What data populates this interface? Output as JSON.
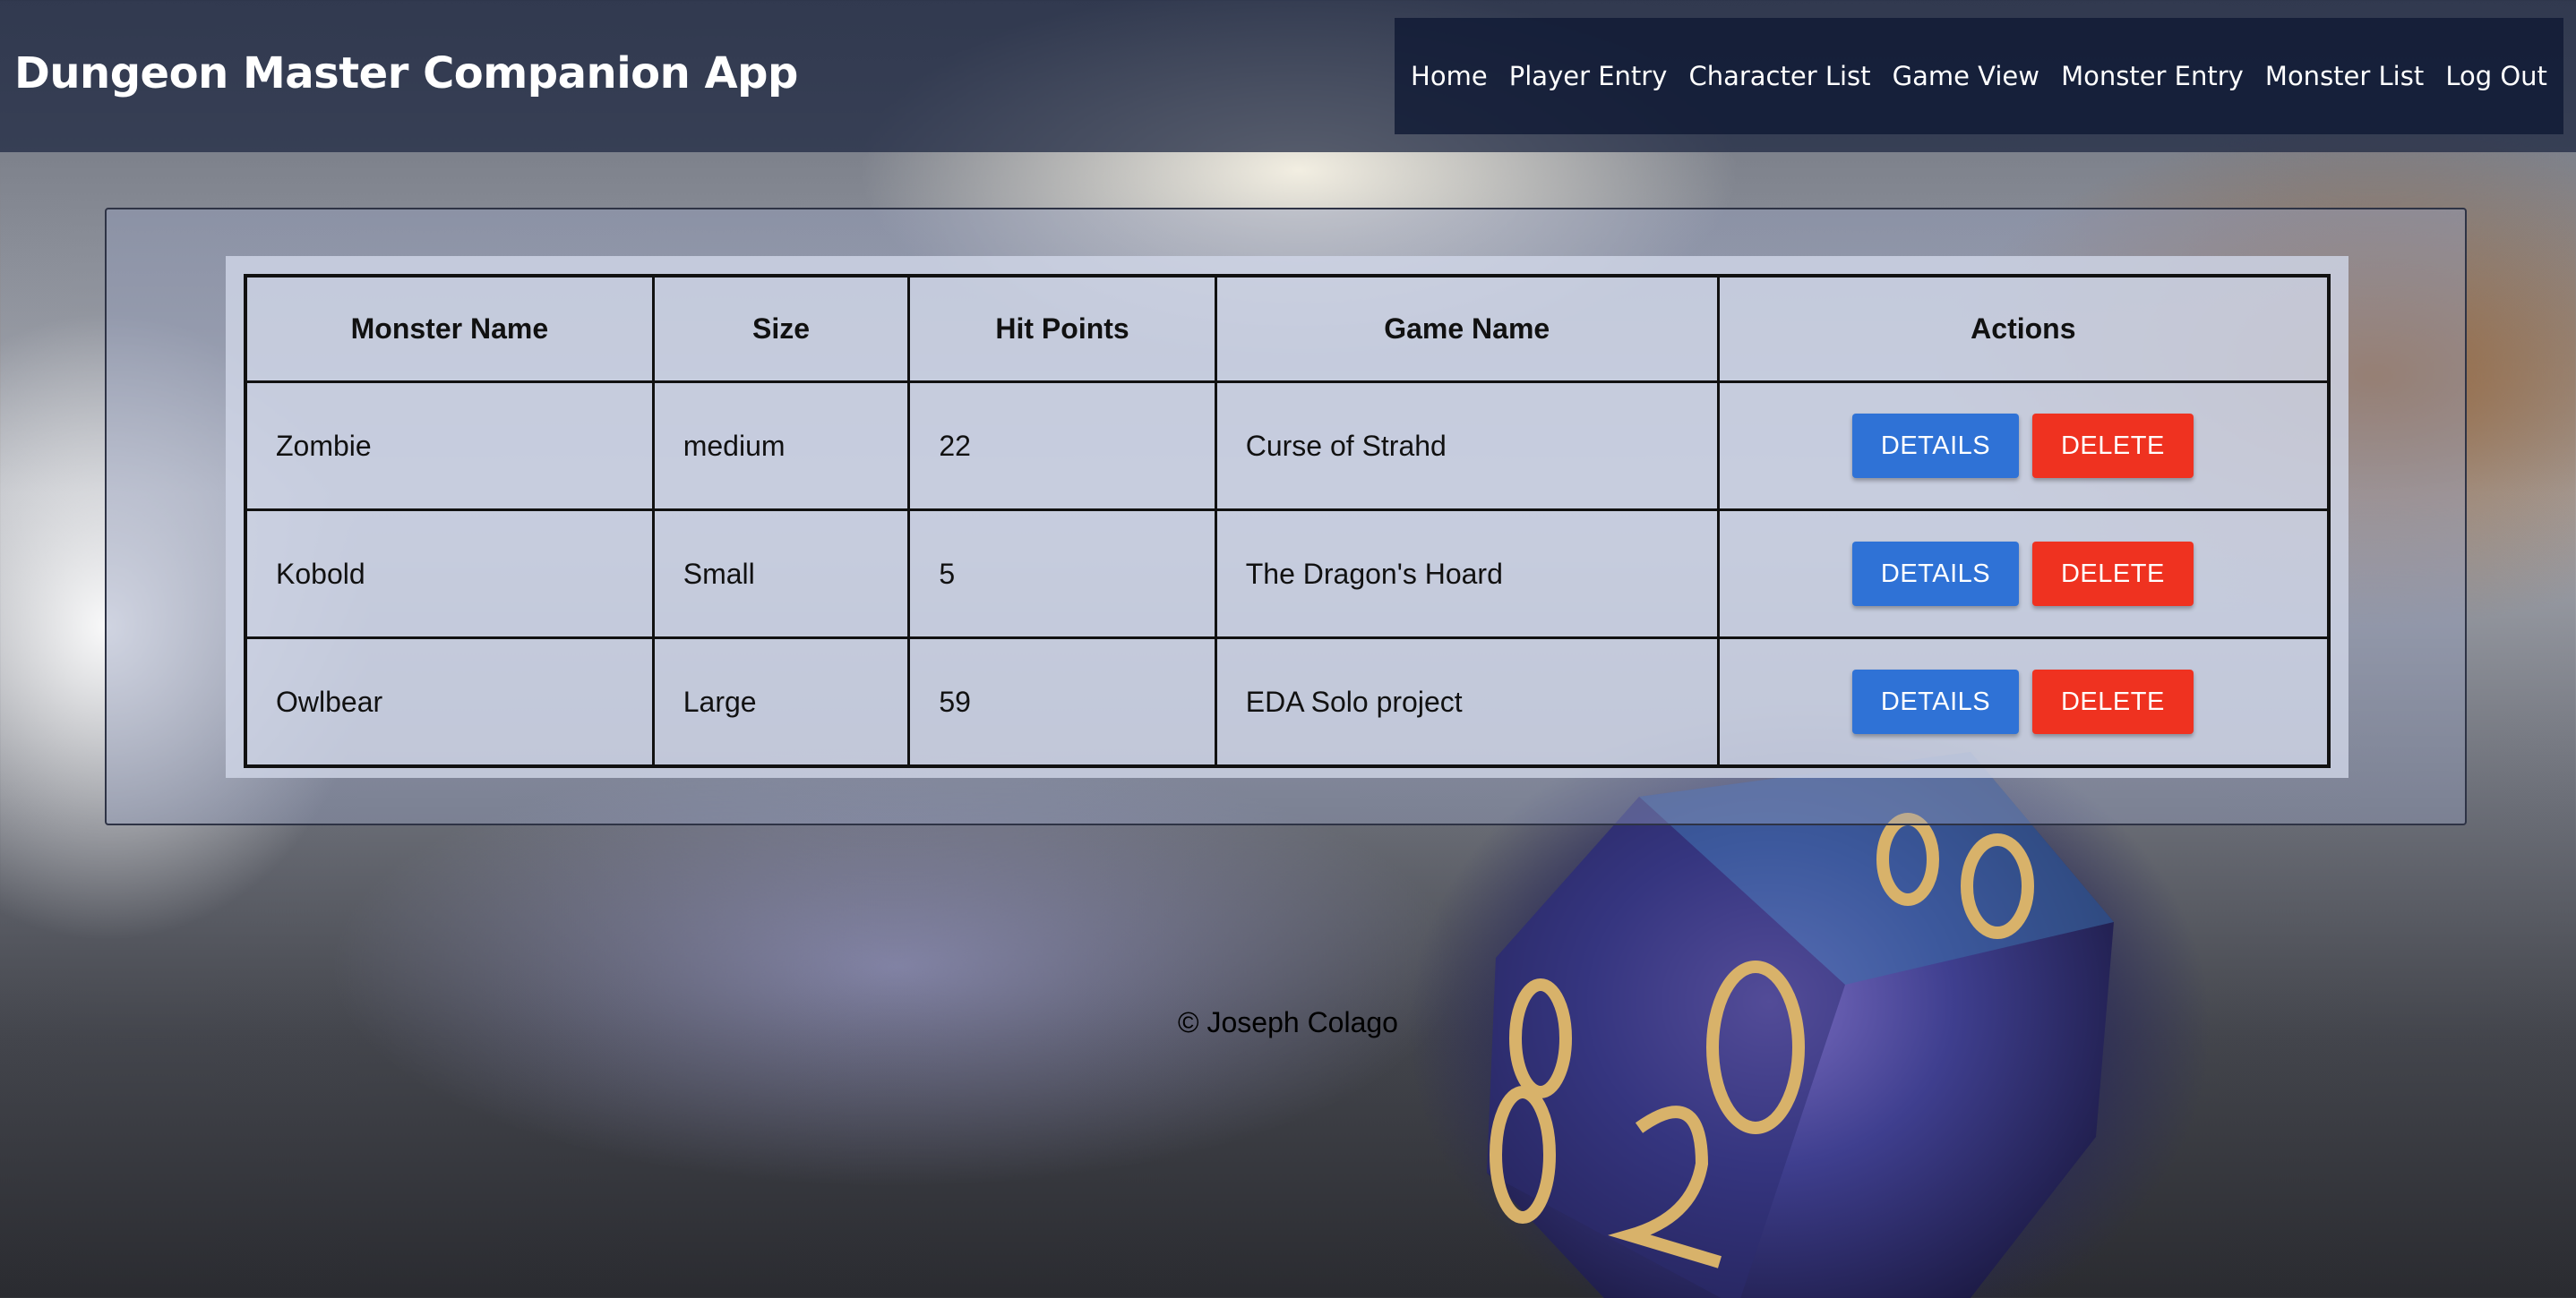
{
  "header": {
    "title": "Dungeon Master Companion App"
  },
  "nav": {
    "items": [
      {
        "label": "Home"
      },
      {
        "label": "Player Entry"
      },
      {
        "label": "Character List"
      },
      {
        "label": "Game View"
      },
      {
        "label": "Monster Entry"
      },
      {
        "label": "Monster List"
      },
      {
        "label": "Log Out"
      }
    ]
  },
  "table": {
    "headers": [
      "Monster Name",
      "Size",
      "Hit Points",
      "Game Name",
      "Actions"
    ],
    "rows": [
      {
        "name": "Zombie",
        "size": "medium",
        "hp": "22",
        "game": "Curse of Strahd"
      },
      {
        "name": "Kobold",
        "size": "Small",
        "hp": "5",
        "game": "The Dragon's Hoard"
      },
      {
        "name": "Owlbear",
        "size": "Large",
        "hp": "59",
        "game": "EDA Solo project"
      }
    ],
    "details_label": "DETAILS",
    "delete_label": "DELETE"
  },
  "footer": {
    "text": "© Joseph Colago"
  },
  "colors": {
    "details_button": "#2f72d6",
    "delete_button": "#ef3220",
    "header_bg": "#1c2640"
  },
  "background": {
    "icon": "d20-dice-icon"
  }
}
